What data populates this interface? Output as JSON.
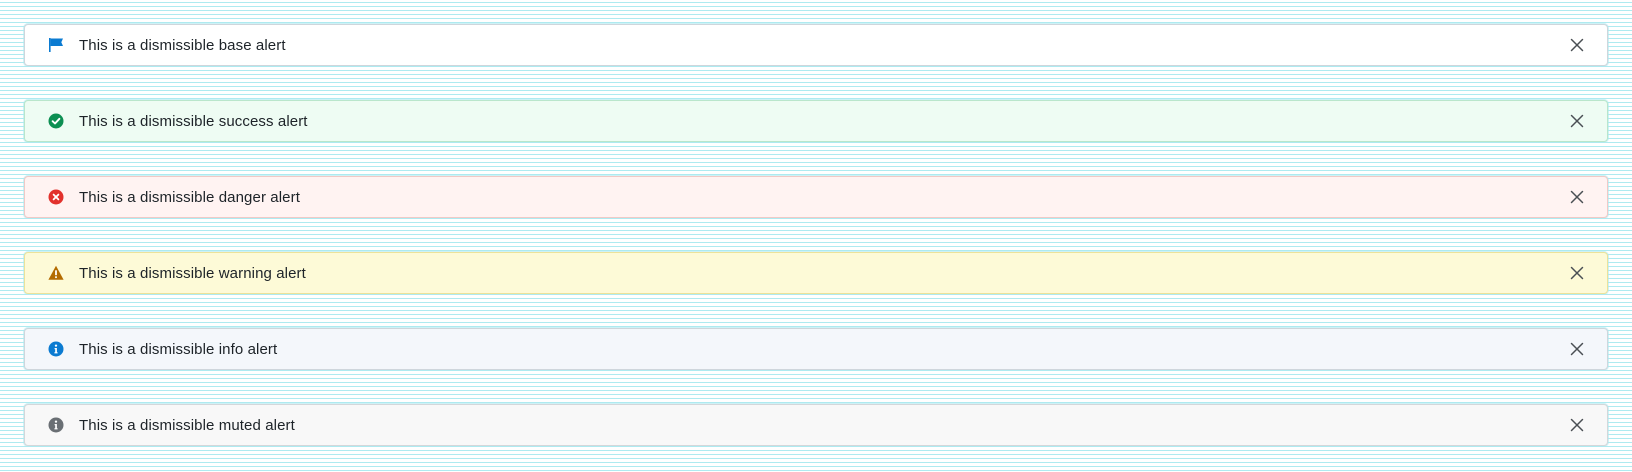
{
  "alerts": [
    {
      "variant": "base",
      "message": "This is a dismissible base alert",
      "icon": "flag-icon",
      "background": "#ffffff",
      "border": "#cfd6dc",
      "icon_color": "#0b7bd1"
    },
    {
      "variant": "success",
      "message": "This is a dismissible success alert",
      "icon": "check-circle-icon",
      "background": "#eefcf3",
      "border": "#b9e6cb",
      "icon_color": "#0c8f52"
    },
    {
      "variant": "danger",
      "message": "This is a dismissible danger alert",
      "icon": "x-circle-icon",
      "background": "#fff3f2",
      "border": "#f1c9c6",
      "icon_color": "#e2312c"
    },
    {
      "variant": "warning",
      "message": "This is a dismissible warning alert",
      "icon": "warning-triangle-icon",
      "background": "#fdfad7",
      "border": "#ece29a",
      "icon_color": "#b36b00"
    },
    {
      "variant": "info",
      "message": "This is a dismissible info alert",
      "icon": "info-circle-icon",
      "background": "#f4f7fb",
      "border": "#cfd6dc",
      "icon_color": "#0b7bd1"
    },
    {
      "variant": "muted",
      "message": "This is a dismissible muted alert",
      "icon": "info-circle-icon",
      "background": "#f8f8f8",
      "border": "#d4d7da",
      "icon_color": "#6a6f74"
    }
  ],
  "close_icon": "close-icon",
  "close_color": "#4a4f54"
}
